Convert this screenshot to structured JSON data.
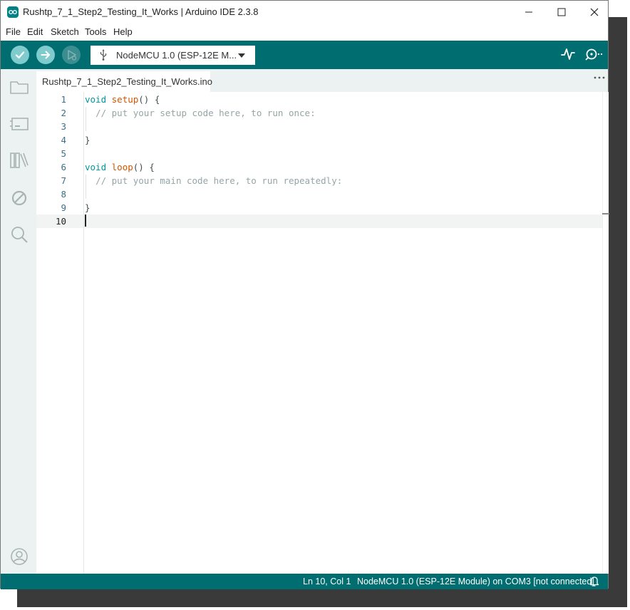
{
  "window": {
    "title": "Rushtp_7_1_Step2_Testing_It_Works | Arduino IDE 2.3.8"
  },
  "menu": [
    "File",
    "Edit",
    "Sketch",
    "Tools",
    "Help"
  ],
  "toolbar": {
    "board": "NodeMCU 1.0 (ESP-12E M..."
  },
  "editor": {
    "tab_label": "Rushtp_7_1_Step2_Testing_It_Works.ino",
    "lines": [
      {
        "n": "1",
        "code": [
          {
            "t": "void",
            "c": "kw"
          },
          {
            "t": " "
          },
          {
            "t": "setup",
            "c": "fn"
          },
          {
            "t": "() {"
          }
        ]
      },
      {
        "n": "2",
        "code": [
          {
            "t": "  "
          },
          {
            "t": "// put your setup code here, to run once:",
            "c": "cm"
          }
        ]
      },
      {
        "n": "3",
        "code": []
      },
      {
        "n": "4",
        "code": [
          {
            "t": "}"
          }
        ]
      },
      {
        "n": "5",
        "code": []
      },
      {
        "n": "6",
        "code": [
          {
            "t": "void",
            "c": "kw"
          },
          {
            "t": " "
          },
          {
            "t": "loop",
            "c": "fn"
          },
          {
            "t": "() {"
          }
        ]
      },
      {
        "n": "7",
        "code": [
          {
            "t": "  "
          },
          {
            "t": "// put your main code here, to run repeatedly:",
            "c": "cm"
          }
        ]
      },
      {
        "n": "8",
        "code": []
      },
      {
        "n": "9",
        "code": [
          {
            "t": "}"
          }
        ]
      },
      {
        "n": "10",
        "code": []
      }
    ]
  },
  "status": {
    "position": "Ln 10, Col 1",
    "board": "NodeMCU 1.0 (ESP-12E Module) on COM3 [not connected]"
  },
  "colors": {
    "toolbar": "#006d70",
    "button": "#7fcbcd",
    "keyword": "#00979c",
    "function": "#d35400",
    "comment": "#95a5a6"
  }
}
